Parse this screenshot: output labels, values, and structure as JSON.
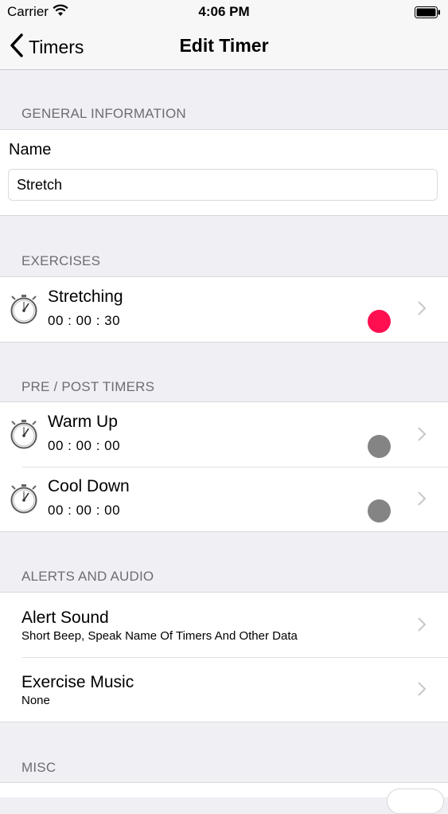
{
  "status_bar": {
    "carrier": "Carrier",
    "time": "4:06 PM"
  },
  "nav": {
    "back_label": "Timers",
    "title": "Edit Timer"
  },
  "general": {
    "header": "GENERAL INFORMATION",
    "name_label": "Name",
    "name_value": "Stretch"
  },
  "exercises": {
    "header": "EXERCISES",
    "items": [
      {
        "name": "Stretching",
        "duration": "00 : 00 : 30",
        "color": "#ff0f50"
      }
    ]
  },
  "pre_post": {
    "header": "PRE / POST TIMERS",
    "items": [
      {
        "name": "Warm Up",
        "duration": "00 : 00 : 00",
        "color": "#848484"
      },
      {
        "name": "Cool Down",
        "duration": "00 : 00 : 00",
        "color": "#848484"
      }
    ]
  },
  "alerts": {
    "header": "ALERTS AND AUDIO",
    "items": [
      {
        "title": "Alert Sound",
        "subtitle": "Short Beep, Speak Name Of Timers And Other Data"
      },
      {
        "title": "Exercise Music",
        "subtitle": "None"
      }
    ]
  },
  "misc": {
    "header": "MISC"
  },
  "icons": {
    "back": "chevron-left-icon",
    "timer": "stopwatch-icon",
    "row": "chevron-right-icon",
    "wifi": "wifi-icon",
    "battery": "battery-icon"
  }
}
